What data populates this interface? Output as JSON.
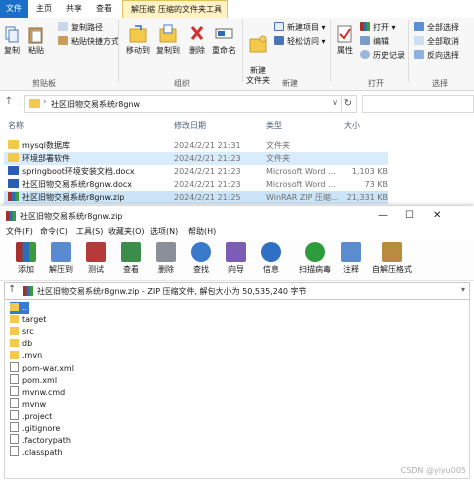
{
  "explorer": {
    "tabs": [
      "文件",
      "主页",
      "共享",
      "查看",
      "解压缩",
      "压缩的文件夹工具"
    ],
    "ribbon": {
      "copy": "复制",
      "paste": "粘贴",
      "copy_path": "复制路径",
      "paste_shortcut": "粘贴快捷方式",
      "clipboard_group": "剪贴板",
      "move_to": "移动到",
      "copy_to": "复制到",
      "delete": "删除",
      "rename": "重命名",
      "organize_group": "组织",
      "new_item": "新建项目",
      "easy_access": "轻松访问",
      "new_folder": "新建\n文件夹",
      "new_group": "新建",
      "properties": "属性",
      "open": "打开",
      "edit": "编辑",
      "history": "历史记录",
      "open_group": "打开",
      "select_all": "全部选择",
      "select_none": "全部取消",
      "invert_select": "反向选择",
      "select_group": "选择"
    },
    "address": "社区旧物交易系统r8gnw",
    "columns": {
      "name": "名称",
      "date": "修改日期",
      "type": "类型",
      "size": "大小"
    },
    "files": [
      {
        "name": "mysql数据库",
        "date": "2024/2/21 21:31",
        "type": "文件夹",
        "size": "",
        "icon": "folder-icon"
      },
      {
        "name": "环境部署软件",
        "date": "2024/2/21 21:23",
        "type": "文件夹",
        "size": "",
        "icon": "folder-icon"
      },
      {
        "name": "springboot环境安装文档.docx",
        "date": "2024/2/21 21:23",
        "type": "Microsoft Word ...",
        "size": "1,103 KB",
        "icon": "word-doc-icon"
      },
      {
        "name": "社区旧物交易系统r8gnw.docx",
        "date": "2024/2/21 21:23",
        "type": "Microsoft Word ...",
        "size": "73 KB",
        "icon": "word-doc-icon"
      },
      {
        "name": "社区旧物交易系统r8gnw.zip",
        "date": "2024/2/21 21:25",
        "type": "WinRAR ZIP 压缩...",
        "size": "21,331 KB",
        "icon": "winrar-archive-icon"
      }
    ]
  },
  "winrar": {
    "title": "社区旧物交易系统r8gnw.zip",
    "menu": [
      "文件(F)",
      "命令(C)",
      "工具(S)",
      "收藏夹(O)",
      "选项(N)",
      "帮助(H)"
    ],
    "toolbar": [
      "添加",
      "解压到",
      "测试",
      "查看",
      "删除",
      "查找",
      "向导",
      "信息",
      "扫描病毒",
      "注释",
      "自解压格式"
    ],
    "path": "社区旧物交易系统r8gnw.zip - ZIP 压缩文件, 解包大小为 50,535,240 字节",
    "items": [
      {
        "name": "..",
        "kind": "dir"
      },
      {
        "name": "target",
        "kind": "dir"
      },
      {
        "name": "src",
        "kind": "dir"
      },
      {
        "name": "db",
        "kind": "dir"
      },
      {
        "name": ".mvn",
        "kind": "dir"
      },
      {
        "name": "pom-war.xml",
        "kind": "file"
      },
      {
        "name": "pom.xml",
        "kind": "file"
      },
      {
        "name": "mvnw.cmd",
        "kind": "file"
      },
      {
        "name": "mvnw",
        "kind": "file"
      },
      {
        "name": ".project",
        "kind": "file"
      },
      {
        "name": ".gitignore",
        "kind": "file"
      },
      {
        "name": ".factorypath",
        "kind": "file"
      },
      {
        "name": ".classpath",
        "kind": "file"
      }
    ]
  },
  "watermark": "CSDN @yiyu005",
  "colors": {
    "accent": "#1a6fc9",
    "selection": "#cce4f7",
    "folder": "#f3c94a",
    "active_tab": "#fff3c4"
  }
}
